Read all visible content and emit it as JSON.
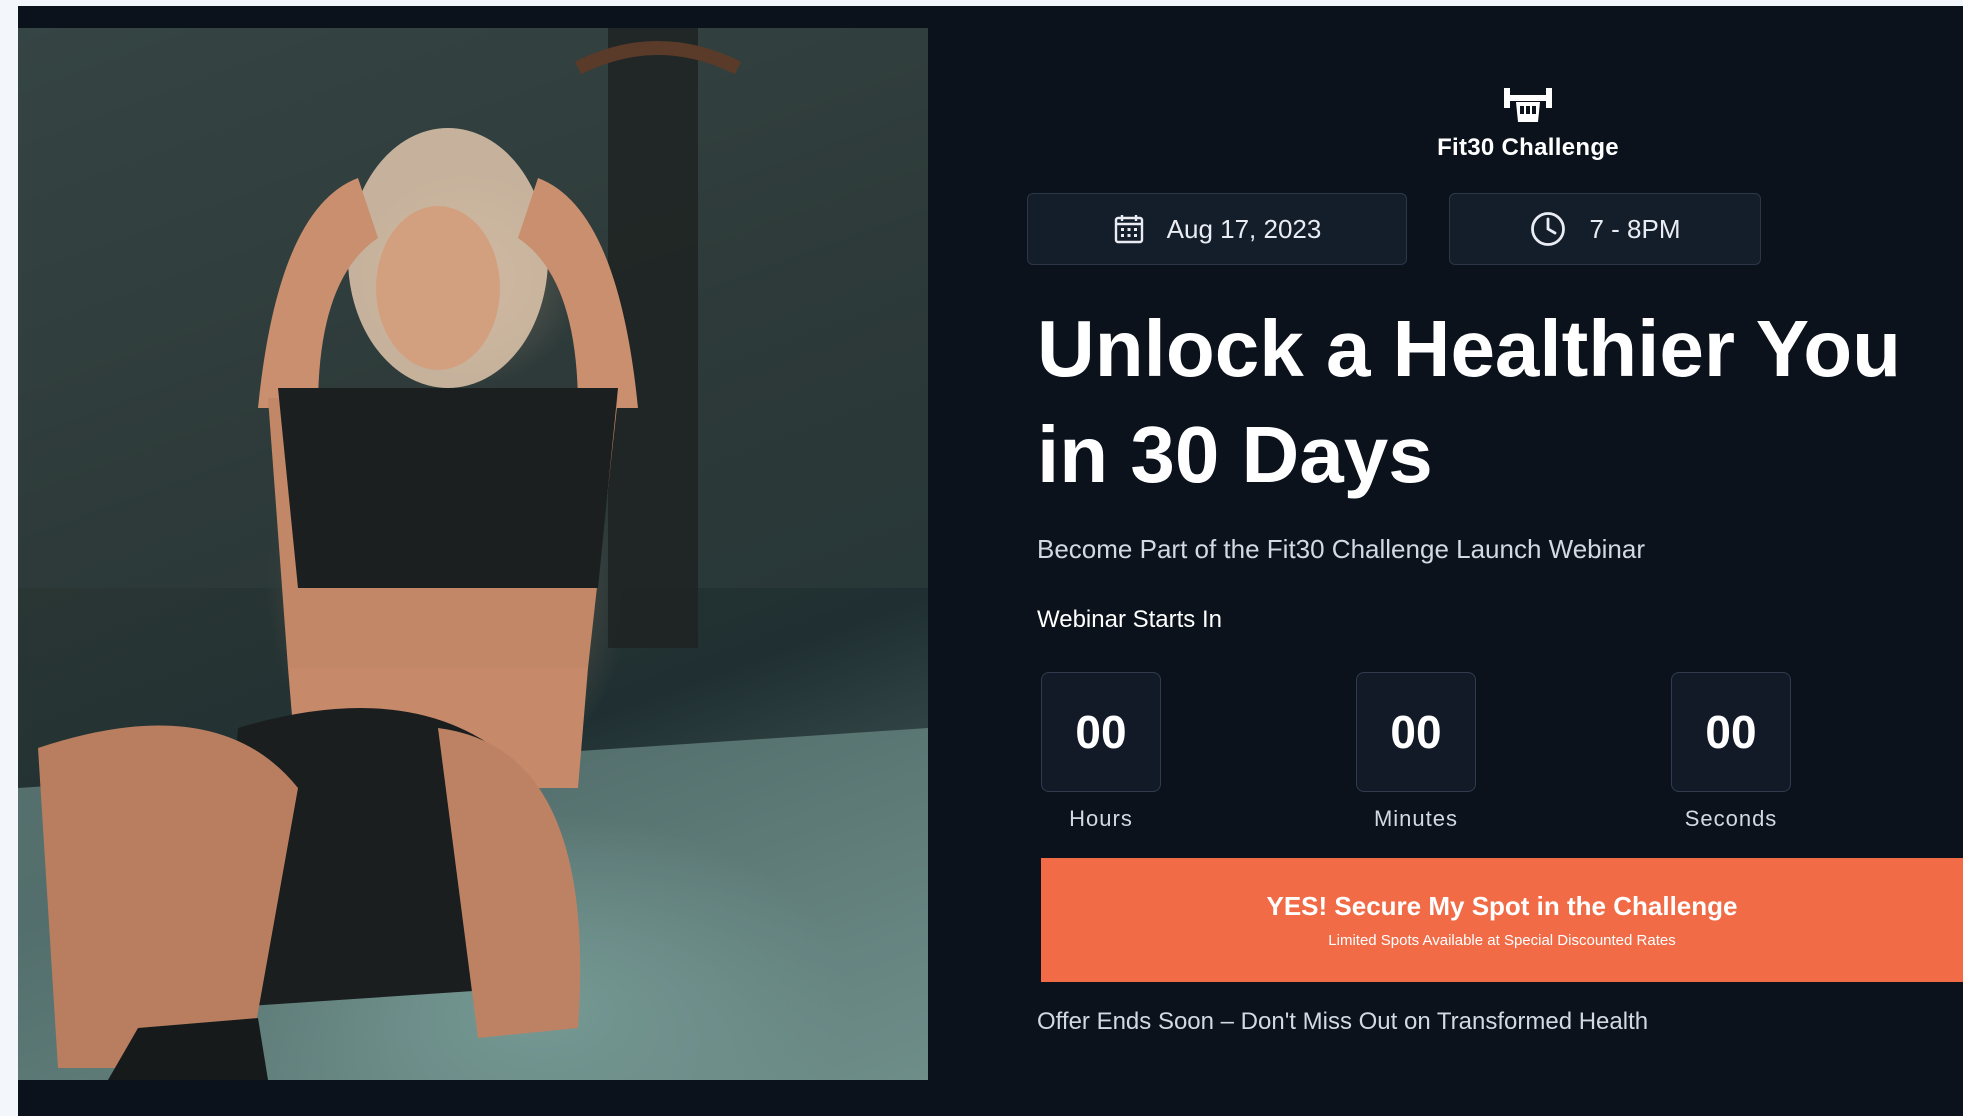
{
  "brand": {
    "name": "Fit30 Challenge",
    "icon": "dumbbell-fist-icon"
  },
  "event": {
    "date": "Aug 17, 2023",
    "date_icon": "calendar-icon",
    "time": "7 - 8PM",
    "time_icon": "clock-icon"
  },
  "hero": {
    "headline_line1": "Unlock a Healthier You",
    "headline_line2": "in 30 Days",
    "subheadline": "Become Part of the Fit30 Challenge Launch Webinar"
  },
  "countdown": {
    "label": "Webinar Starts In",
    "units": [
      {
        "value": "00",
        "label": "Hours"
      },
      {
        "value": "00",
        "label": "Minutes"
      },
      {
        "value": "00",
        "label": "Seconds"
      }
    ]
  },
  "cta": {
    "label": "YES! Secure My Spot in the Challenge",
    "sublabel": "Limited Spots Available at Special Discounted Rates"
  },
  "offer_note": "Offer Ends Soon – Don't Miss Out on Transformed Health",
  "colors": {
    "background": "#0b121c",
    "card": "#141d2a",
    "accent": "#f26b47",
    "text": "#ffffff"
  }
}
